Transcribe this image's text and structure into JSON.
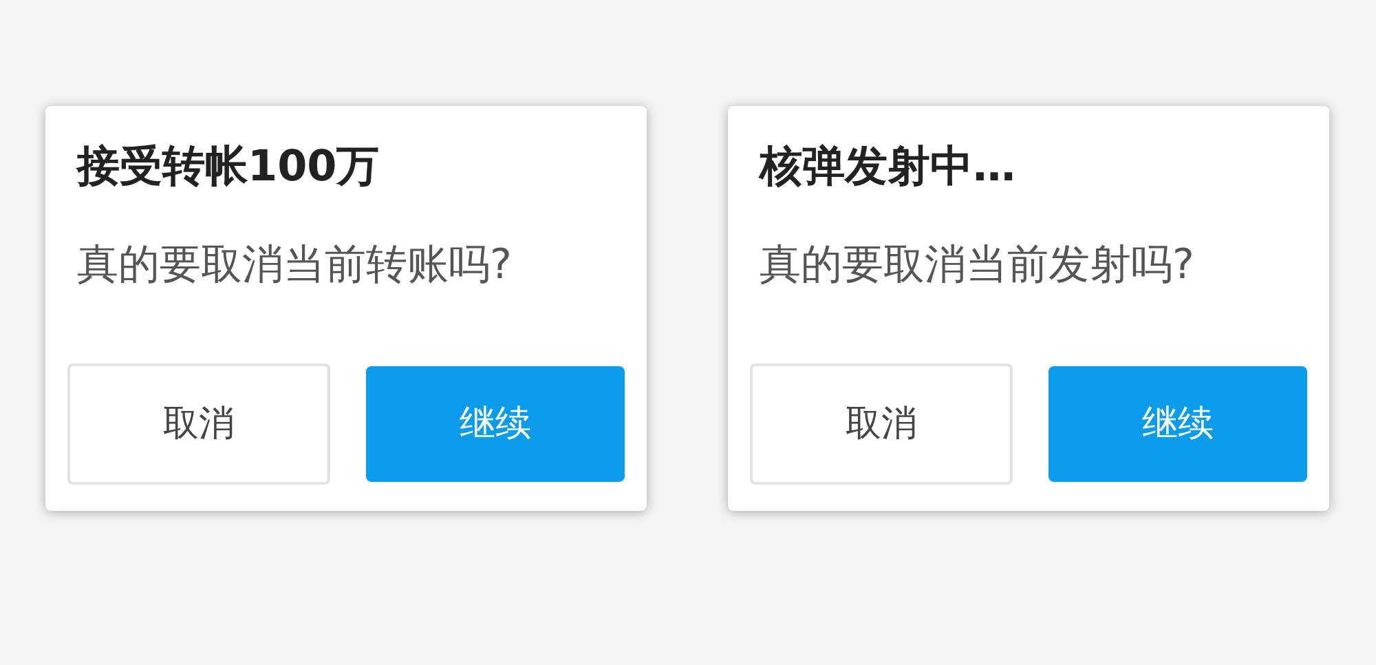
{
  "dialogs": [
    {
      "title": "接受转帐100万",
      "message": "真的要取消当前转账吗?",
      "buttons": [
        {
          "label": "取消",
          "kind": "secondary"
        },
        {
          "label": "继续",
          "kind": "primary"
        }
      ]
    },
    {
      "title": "核弹发射中…",
      "message": "真的要取消当前发射吗?",
      "buttons": [
        {
          "label": "取消",
          "kind": "secondary"
        },
        {
          "label": "继续",
          "kind": "primary"
        }
      ]
    }
  ]
}
